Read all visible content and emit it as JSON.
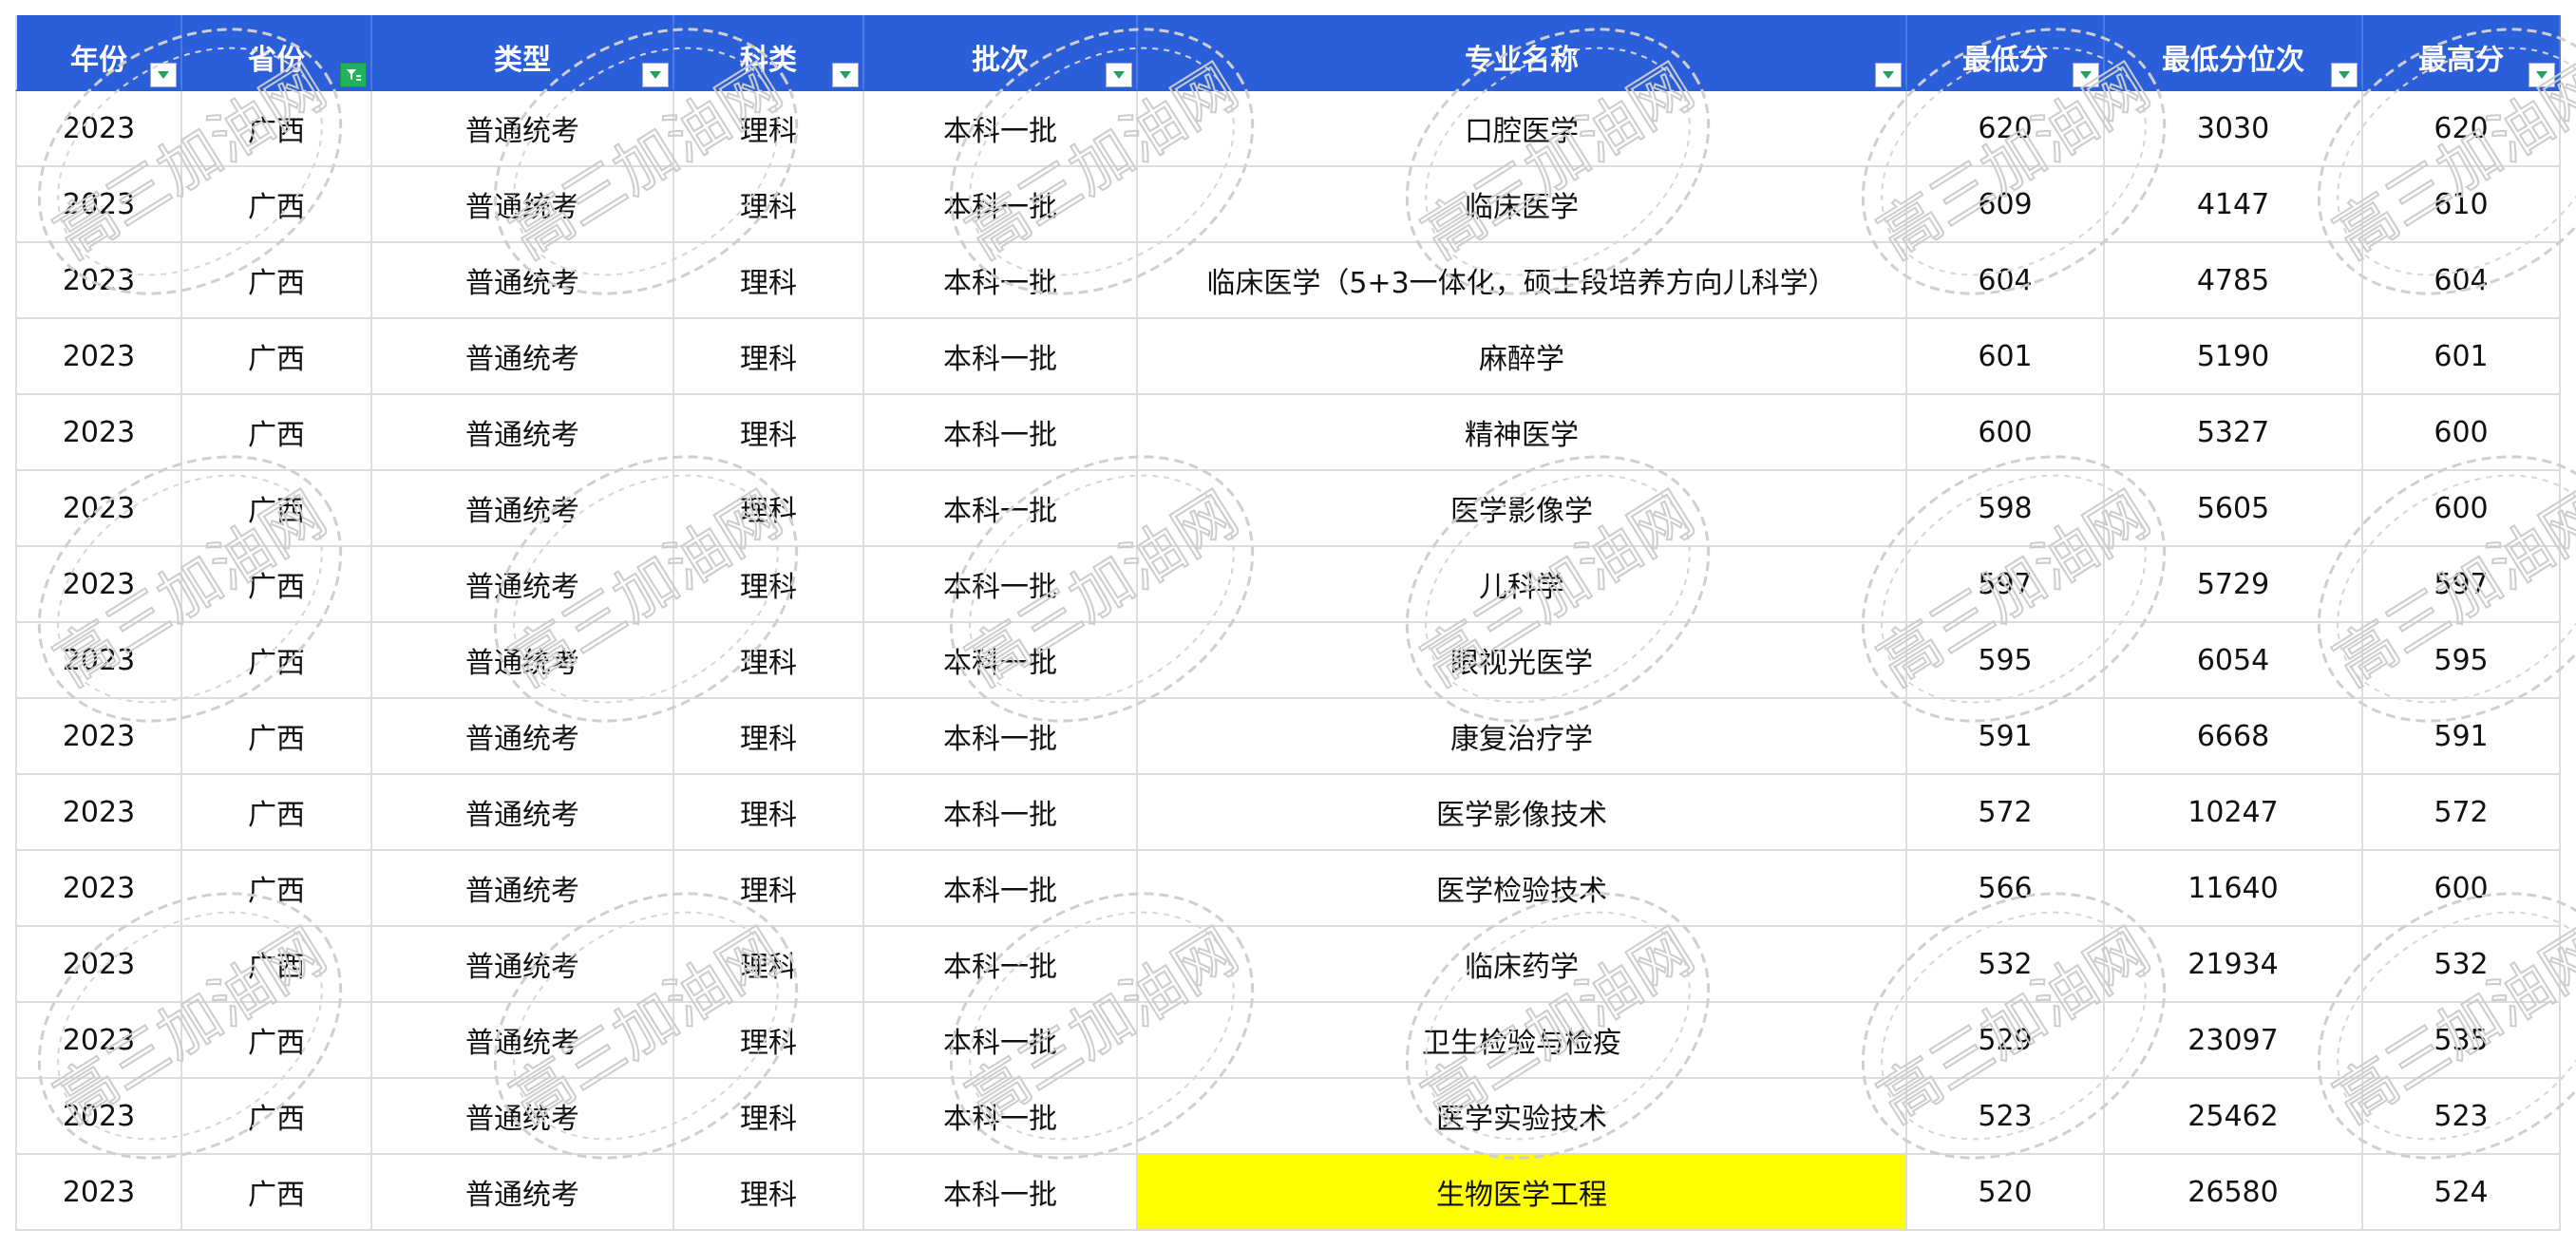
{
  "watermark": {
    "text": "高三加油网"
  },
  "table": {
    "columns": [
      {
        "label": "年份",
        "filter": "normal"
      },
      {
        "label": "省份",
        "filter": "active"
      },
      {
        "label": "类型",
        "filter": "normal"
      },
      {
        "label": "科类",
        "filter": "normal"
      },
      {
        "label": "批次",
        "filter": "normal"
      },
      {
        "label": "专业名称",
        "filter": "normal"
      },
      {
        "label": "最低分",
        "filter": "normal"
      },
      {
        "label": "最低分位次",
        "filter": "normal"
      },
      {
        "label": "最高分",
        "filter": "normal"
      }
    ],
    "rows": [
      [
        "2023",
        "广西",
        "普通统考",
        "理科",
        "本科一批",
        "口腔医学",
        "620",
        "3030",
        "620"
      ],
      [
        "2023",
        "广西",
        "普通统考",
        "理科",
        "本科一批",
        "临床医学",
        "609",
        "4147",
        "610"
      ],
      [
        "2023",
        "广西",
        "普通统考",
        "理科",
        "本科一批",
        "临床医学（5+3一体化，硕士段培养方向儿科学）",
        "604",
        "4785",
        "604"
      ],
      [
        "2023",
        "广西",
        "普通统考",
        "理科",
        "本科一批",
        "麻醉学",
        "601",
        "5190",
        "601"
      ],
      [
        "2023",
        "广西",
        "普通统考",
        "理科",
        "本科一批",
        "精神医学",
        "600",
        "5327",
        "600"
      ],
      [
        "2023",
        "广西",
        "普通统考",
        "理科",
        "本科一批",
        "医学影像学",
        "598",
        "5605",
        "600"
      ],
      [
        "2023",
        "广西",
        "普通统考",
        "理科",
        "本科一批",
        "儿科学",
        "597",
        "5729",
        "597"
      ],
      [
        "2023",
        "广西",
        "普通统考",
        "理科",
        "本科一批",
        "眼视光医学",
        "595",
        "6054",
        "595"
      ],
      [
        "2023",
        "广西",
        "普通统考",
        "理科",
        "本科一批",
        "康复治疗学",
        "591",
        "6668",
        "591"
      ],
      [
        "2023",
        "广西",
        "普通统考",
        "理科",
        "本科一批",
        "医学影像技术",
        "572",
        "10247",
        "572"
      ],
      [
        "2023",
        "广西",
        "普通统考",
        "理科",
        "本科一批",
        "医学检验技术",
        "566",
        "11640",
        "600"
      ],
      [
        "2023",
        "广西",
        "普通统考",
        "理科",
        "本科一批",
        "临床药学",
        "532",
        "21934",
        "532"
      ],
      [
        "2023",
        "广西",
        "普通统考",
        "理科",
        "本科一批",
        "卫生检验与检疫",
        "529",
        "23097",
        "535"
      ],
      [
        "2023",
        "广西",
        "普通统考",
        "理科",
        "本科一批",
        "医学实验技术",
        "523",
        "25462",
        "523"
      ],
      [
        "2023",
        "广西",
        "普通统考",
        "理科",
        "本科一批",
        "生物医学工程",
        "520",
        "26580",
        "524"
      ]
    ],
    "highlight": {
      "row": 14,
      "col": 5,
      "color": "#ffff00"
    }
  },
  "colors": {
    "header_bg": "#2b5fd9",
    "header_text": "#ffffff",
    "grid": "#dcdcdc",
    "filter_active": "#22b35a"
  }
}
